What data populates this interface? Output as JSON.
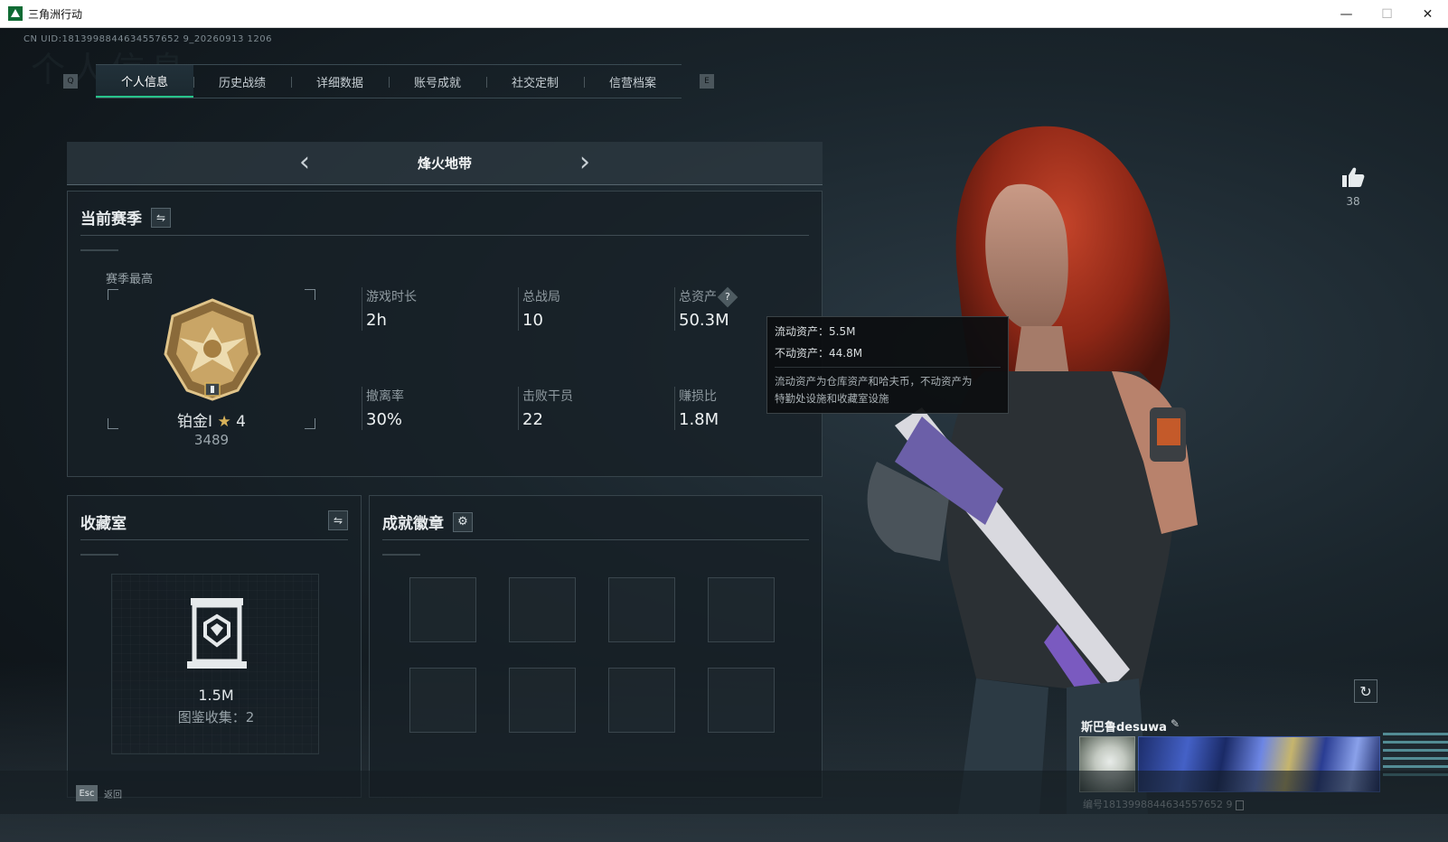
{
  "window": {
    "title": "三角洲行动",
    "minimize": "—",
    "maximize": "☐",
    "close": "✕"
  },
  "header": {
    "uid": "CN UID:1813998844634557652 9_20260913 1206",
    "watermark": "个人信息"
  },
  "tabs": {
    "left_key": "Q",
    "right_key": "E",
    "items": [
      {
        "label": "个人信息",
        "active": true
      },
      {
        "label": "历史战绩",
        "active": false
      },
      {
        "label": "详细数据",
        "active": false
      },
      {
        "label": "账号成就",
        "active": false
      },
      {
        "label": "社交定制",
        "active": false
      },
      {
        "label": "信营档案",
        "active": false
      }
    ]
  },
  "mode": {
    "title": "烽火地带",
    "prev": "‹",
    "next": "›"
  },
  "season": {
    "title": "当前赛季",
    "swap_icon": "⇋",
    "best_label": "赛季最高",
    "rank_name": "铂金I",
    "rank_star": "★",
    "rank_stars": "4",
    "rank_score": "3489",
    "stats": [
      {
        "label": "游戏时长",
        "value": "2h"
      },
      {
        "label": "总战局",
        "value": "10"
      },
      {
        "label": "总资产",
        "value": "50.3M",
        "help": "?"
      },
      {
        "label": "撤离率",
        "value": "30%"
      },
      {
        "label": "击败干员",
        "value": "22"
      },
      {
        "label": "赚损比",
        "value": "1.8M"
      }
    ]
  },
  "tooltip": {
    "liquid": "流动资产：5.5M",
    "fixed": "不动资产：44.8M",
    "desc_line1": "流动资产为仓库资产和哈夫币，不动资产为",
    "desc_line2": "特勤处设施和收藏室设施"
  },
  "collection": {
    "title": "收藏室",
    "swap_icon": "⇋",
    "value": "1.5M",
    "count": "图鉴收集：2"
  },
  "achievements": {
    "title": "成就徽章",
    "gear_icon": "⚙",
    "slots": 8
  },
  "bottom": {
    "esc_key": "Esc",
    "esc_label": "返回"
  },
  "profile": {
    "like_count": "38",
    "refresh_icon": "↻",
    "player_name": "斯巴鲁desuwa",
    "edit_icon": "✎",
    "player_id": "编号1813998844634557652 9"
  },
  "colors": {
    "accent": "#28c38a",
    "rank_gold": "#d8b25a"
  }
}
